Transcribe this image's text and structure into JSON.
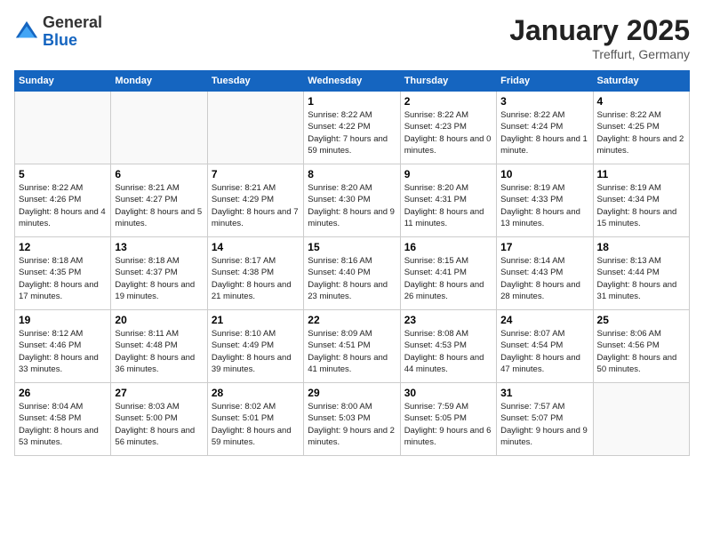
{
  "header": {
    "logo_general": "General",
    "logo_blue": "Blue",
    "month_title": "January 2025",
    "subtitle": "Treffurt, Germany"
  },
  "days_of_week": [
    "Sunday",
    "Monday",
    "Tuesday",
    "Wednesday",
    "Thursday",
    "Friday",
    "Saturday"
  ],
  "weeks": [
    [
      {
        "day": "",
        "content": ""
      },
      {
        "day": "",
        "content": ""
      },
      {
        "day": "",
        "content": ""
      },
      {
        "day": "1",
        "content": "Sunrise: 8:22 AM\nSunset: 4:22 PM\nDaylight: 7 hours and 59 minutes."
      },
      {
        "day": "2",
        "content": "Sunrise: 8:22 AM\nSunset: 4:23 PM\nDaylight: 8 hours and 0 minutes."
      },
      {
        "day": "3",
        "content": "Sunrise: 8:22 AM\nSunset: 4:24 PM\nDaylight: 8 hours and 1 minute."
      },
      {
        "day": "4",
        "content": "Sunrise: 8:22 AM\nSunset: 4:25 PM\nDaylight: 8 hours and 2 minutes."
      }
    ],
    [
      {
        "day": "5",
        "content": "Sunrise: 8:22 AM\nSunset: 4:26 PM\nDaylight: 8 hours and 4 minutes."
      },
      {
        "day": "6",
        "content": "Sunrise: 8:21 AM\nSunset: 4:27 PM\nDaylight: 8 hours and 5 minutes."
      },
      {
        "day": "7",
        "content": "Sunrise: 8:21 AM\nSunset: 4:29 PM\nDaylight: 8 hours and 7 minutes."
      },
      {
        "day": "8",
        "content": "Sunrise: 8:20 AM\nSunset: 4:30 PM\nDaylight: 8 hours and 9 minutes."
      },
      {
        "day": "9",
        "content": "Sunrise: 8:20 AM\nSunset: 4:31 PM\nDaylight: 8 hours and 11 minutes."
      },
      {
        "day": "10",
        "content": "Sunrise: 8:19 AM\nSunset: 4:33 PM\nDaylight: 8 hours and 13 minutes."
      },
      {
        "day": "11",
        "content": "Sunrise: 8:19 AM\nSunset: 4:34 PM\nDaylight: 8 hours and 15 minutes."
      }
    ],
    [
      {
        "day": "12",
        "content": "Sunrise: 8:18 AM\nSunset: 4:35 PM\nDaylight: 8 hours and 17 minutes."
      },
      {
        "day": "13",
        "content": "Sunrise: 8:18 AM\nSunset: 4:37 PM\nDaylight: 8 hours and 19 minutes."
      },
      {
        "day": "14",
        "content": "Sunrise: 8:17 AM\nSunset: 4:38 PM\nDaylight: 8 hours and 21 minutes."
      },
      {
        "day": "15",
        "content": "Sunrise: 8:16 AM\nSunset: 4:40 PM\nDaylight: 8 hours and 23 minutes."
      },
      {
        "day": "16",
        "content": "Sunrise: 8:15 AM\nSunset: 4:41 PM\nDaylight: 8 hours and 26 minutes."
      },
      {
        "day": "17",
        "content": "Sunrise: 8:14 AM\nSunset: 4:43 PM\nDaylight: 8 hours and 28 minutes."
      },
      {
        "day": "18",
        "content": "Sunrise: 8:13 AM\nSunset: 4:44 PM\nDaylight: 8 hours and 31 minutes."
      }
    ],
    [
      {
        "day": "19",
        "content": "Sunrise: 8:12 AM\nSunset: 4:46 PM\nDaylight: 8 hours and 33 minutes."
      },
      {
        "day": "20",
        "content": "Sunrise: 8:11 AM\nSunset: 4:48 PM\nDaylight: 8 hours and 36 minutes."
      },
      {
        "day": "21",
        "content": "Sunrise: 8:10 AM\nSunset: 4:49 PM\nDaylight: 8 hours and 39 minutes."
      },
      {
        "day": "22",
        "content": "Sunrise: 8:09 AM\nSunset: 4:51 PM\nDaylight: 8 hours and 41 minutes."
      },
      {
        "day": "23",
        "content": "Sunrise: 8:08 AM\nSunset: 4:53 PM\nDaylight: 8 hours and 44 minutes."
      },
      {
        "day": "24",
        "content": "Sunrise: 8:07 AM\nSunset: 4:54 PM\nDaylight: 8 hours and 47 minutes."
      },
      {
        "day": "25",
        "content": "Sunrise: 8:06 AM\nSunset: 4:56 PM\nDaylight: 8 hours and 50 minutes."
      }
    ],
    [
      {
        "day": "26",
        "content": "Sunrise: 8:04 AM\nSunset: 4:58 PM\nDaylight: 8 hours and 53 minutes."
      },
      {
        "day": "27",
        "content": "Sunrise: 8:03 AM\nSunset: 5:00 PM\nDaylight: 8 hours and 56 minutes."
      },
      {
        "day": "28",
        "content": "Sunrise: 8:02 AM\nSunset: 5:01 PM\nDaylight: 8 hours and 59 minutes."
      },
      {
        "day": "29",
        "content": "Sunrise: 8:00 AM\nSunset: 5:03 PM\nDaylight: 9 hours and 2 minutes."
      },
      {
        "day": "30",
        "content": "Sunrise: 7:59 AM\nSunset: 5:05 PM\nDaylight: 9 hours and 6 minutes."
      },
      {
        "day": "31",
        "content": "Sunrise: 7:57 AM\nSunset: 5:07 PM\nDaylight: 9 hours and 9 minutes."
      },
      {
        "day": "",
        "content": ""
      }
    ]
  ]
}
